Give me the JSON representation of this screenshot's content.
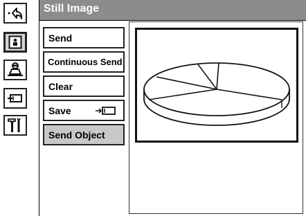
{
  "title": "Still Image",
  "sidebar": {
    "icons": [
      "back-arrow-icon",
      "person-icon",
      "presenter-icon",
      "memory-card-icon",
      "tools-icon"
    ]
  },
  "menu": {
    "items": [
      {
        "label": "Send"
      },
      {
        "label": "Continuous Send"
      },
      {
        "label": "Clear"
      },
      {
        "label": "Save"
      },
      {
        "label": "Send Object"
      }
    ]
  },
  "preview": {
    "content": "pie-chart-image"
  },
  "colors": {
    "title_bar": "#8c8c8c",
    "selected_item": "#c8c8c8",
    "active_icon": "#d4d4d4"
  }
}
